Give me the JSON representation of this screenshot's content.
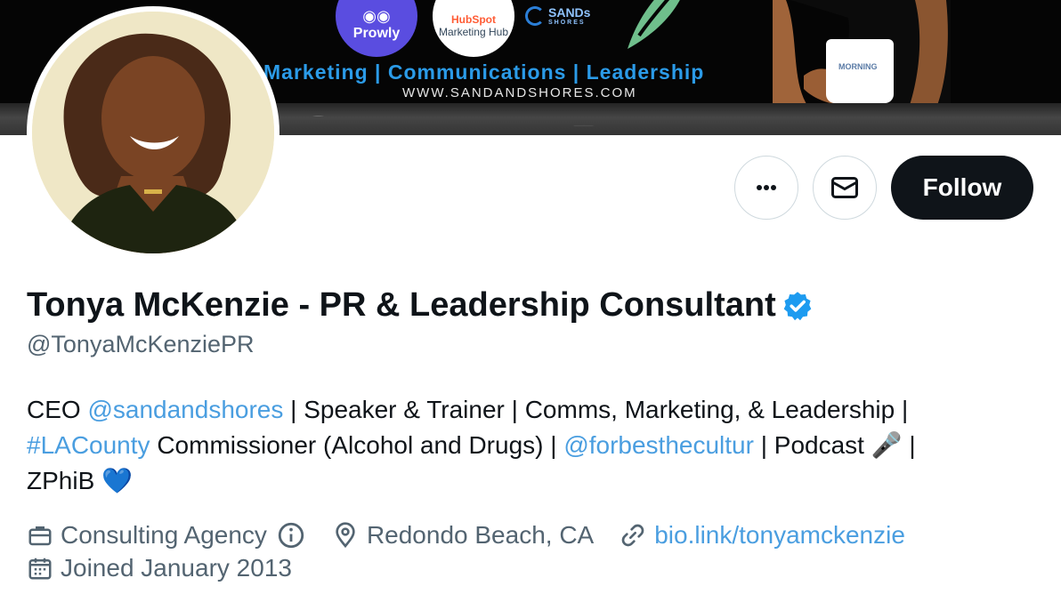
{
  "banner": {
    "logo_prowly": "Prowly",
    "logo_hubspot_brand": "HubSpot",
    "logo_hubspot_sub": "Marketing Hub",
    "logo_sands": "SANDs",
    "logo_sands_sub": "SHORES",
    "tagline": "Marketing | Communications | Leadership",
    "website": "WWW.SANDANDSHORES.COM",
    "mug_text": "MORNING"
  },
  "actions": {
    "more_icon": "more-dots-icon",
    "message_icon": "envelope-icon",
    "follow_label": "Follow"
  },
  "profile": {
    "name": "Tonya McKenzie - PR & Leadership Consultant",
    "verified_icon": "verified-badge-icon",
    "handle": "@TonyaMcKenziePR"
  },
  "bio": {
    "part1": "CEO ",
    "mention1": "@sandandshores",
    "part2": " | Speaker & Trainer | Comms, Marketing, & Leadership |",
    "hashtag": "#LACounty",
    "part3": " Commissioner (Alcohol and Drugs) | ",
    "mention2": "@forbesthecultur",
    "part4": " | Podcast 🎤 |",
    "part5": "ZPhiB 💙"
  },
  "meta": {
    "category": "Consulting Agency",
    "location": "Redondo Beach, CA",
    "website": "bio.link/tonyamckenzie",
    "joined": "Joined January 2013"
  },
  "colors": {
    "link": "#4a9ee0",
    "verified": "#1d9bf0",
    "follow_bg": "#0f1419",
    "muted": "#536471"
  }
}
